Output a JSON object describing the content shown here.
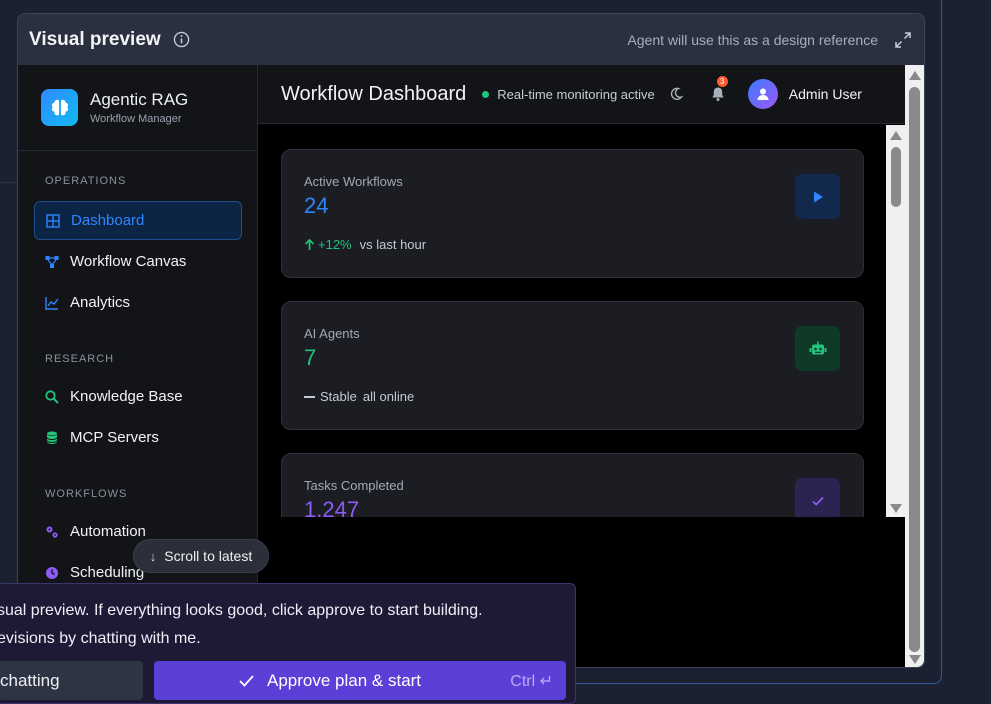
{
  "panel": {
    "title": "Visual preview",
    "hint": "Agent will use this as a design reference"
  },
  "app": {
    "brand": {
      "name": "Agentic RAG",
      "subtitle": "Workflow Manager"
    },
    "sections": {
      "operations": "OPERATIONS",
      "research": "RESEARCH",
      "workflows": "WORKFLOWS"
    },
    "nav": {
      "dashboard": "Dashboard",
      "workflow_canvas": "Workflow Canvas",
      "analytics": "Analytics",
      "knowledge_base": "Knowledge Base",
      "mcp_servers": "MCP Servers",
      "automation": "Automation",
      "scheduling": "Scheduling"
    },
    "topbar": {
      "title": "Workflow Dashboard",
      "status": "Real-time monitoring active",
      "notifications": "3",
      "user": "Admin User"
    },
    "cards": [
      {
        "label": "Active Workflows",
        "value": "24",
        "value_color": "#2e86ff",
        "trend": "+12%",
        "trend_note": "vs last hour",
        "icon": "play-icon",
        "icon_bg": "#12294d",
        "icon_color": "#2e86ff"
      },
      {
        "label": "AI Agents",
        "value": "7",
        "value_color": "#22c37a",
        "trend": "Stable",
        "trend_note": "all online",
        "icon": "robot-icon",
        "icon_bg": "#0f3a28",
        "icon_color": "#22c37a"
      },
      {
        "label": "Tasks Completed",
        "value": "1,247",
        "value_color": "#8b5cf6",
        "icon": "check-icon",
        "icon_bg": "#2c2450",
        "icon_color": "#8b5cf6"
      }
    ]
  },
  "overlay": {
    "scroll_to_latest": "Scroll to latest"
  },
  "chat": {
    "line1": "sual preview. If everything looks good, click approve to start building.",
    "line2": "evisions by chatting with me.",
    "secondary_button": "chatting",
    "primary_button": "Approve plan & start",
    "shortcut": "Ctrl ↵"
  }
}
